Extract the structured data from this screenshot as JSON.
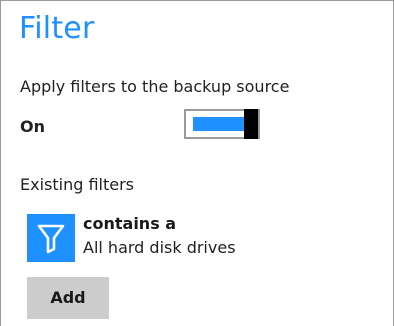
{
  "panel": {
    "title": "Filter",
    "apply_label": "Apply filters to the backup source",
    "state_label": "On",
    "toggle": {
      "state": "on",
      "on_color": "#1e90ff"
    },
    "existing_label": "Existing filters",
    "filters": [
      {
        "icon": "filter-funnel-icon",
        "name": "contains a",
        "description": "All hard disk drives"
      }
    ],
    "add_label": "Add"
  },
  "colors": {
    "accent": "#1e90ff",
    "button_bg": "#cccccc"
  }
}
